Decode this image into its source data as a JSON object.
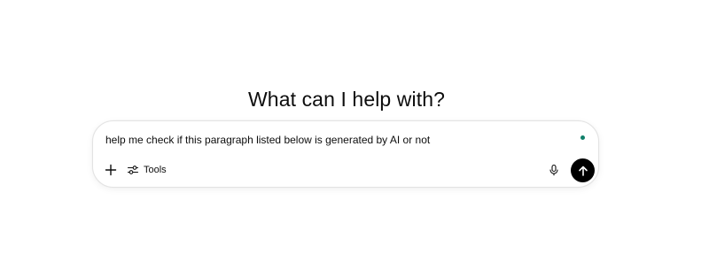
{
  "main": {
    "heading": "What can I help with?"
  },
  "composer": {
    "input_value": "help me check if this paragraph listed below is generated by AI or not",
    "tools_label": "Tools",
    "status_dot_color": "#10806a"
  },
  "icons": {
    "add": "plus-icon",
    "tools": "sliders-icon",
    "voice": "microphone-icon",
    "send": "arrow-up-icon"
  }
}
